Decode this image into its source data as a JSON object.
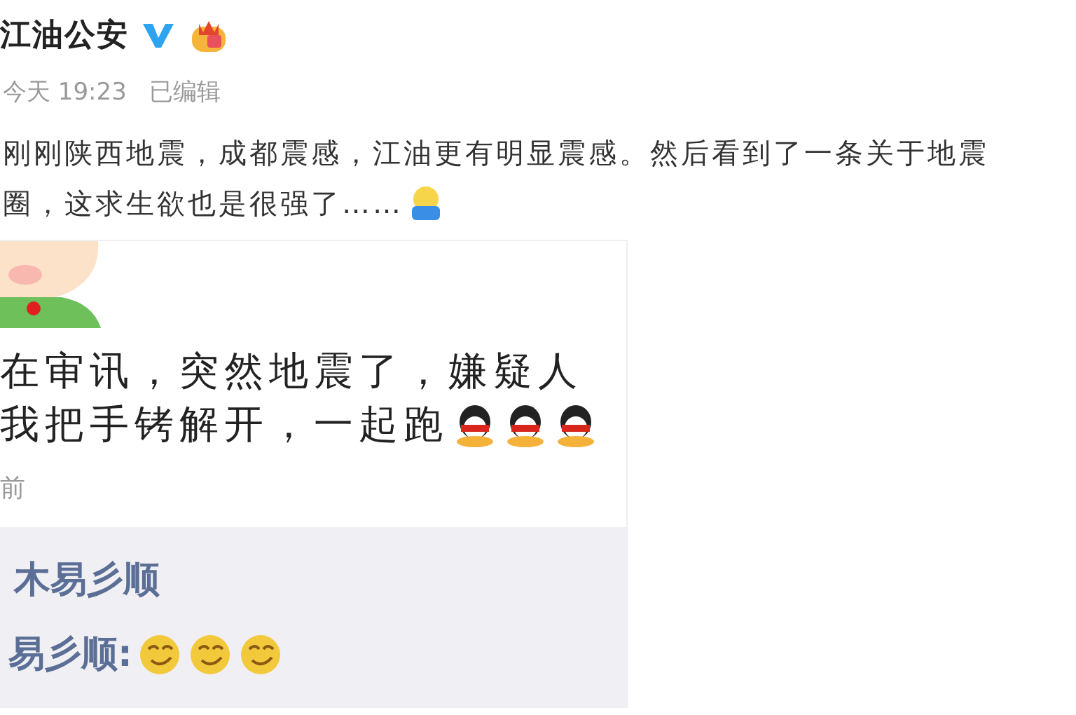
{
  "post": {
    "author": "江油公安",
    "verified": true,
    "time": "今天 19:23",
    "edited": "已编辑",
    "lines": [
      "刚刚陕西地震，成都震感，江油更有明显震感。然后看到了一条关于地震",
      "圈，这求生欲也是很强了……"
    ],
    "repost": {
      "lines": [
        "在审讯，突然地震了，嫌疑人",
        "我把手铐解开，一起跑"
      ],
      "time": "前",
      "comments": [
        {
          "kind": "name",
          "text": "木易彡顺"
        },
        {
          "kind": "reply",
          "text": "易彡顺:"
        }
      ]
    }
  }
}
